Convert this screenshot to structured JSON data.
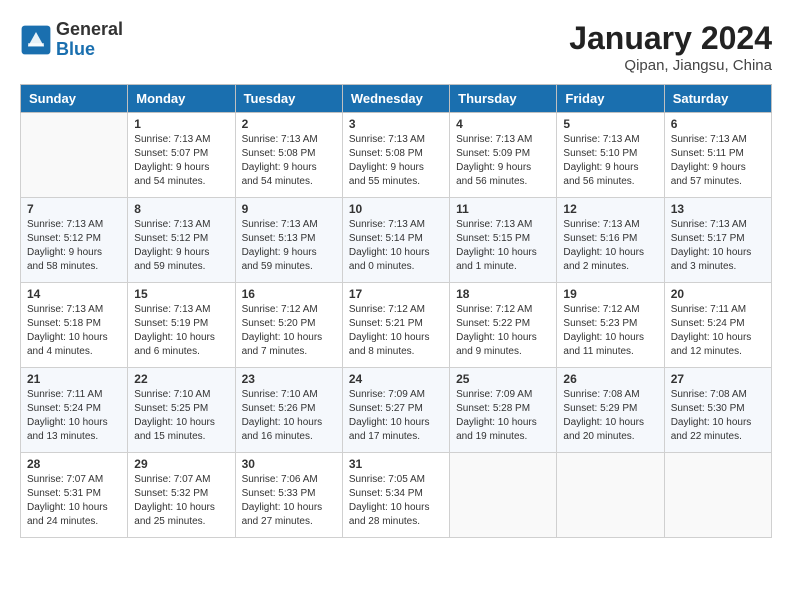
{
  "header": {
    "logo_general": "General",
    "logo_blue": "Blue",
    "month_title": "January 2024",
    "subtitle": "Qipan, Jiangsu, China"
  },
  "weekdays": [
    "Sunday",
    "Monday",
    "Tuesday",
    "Wednesday",
    "Thursday",
    "Friday",
    "Saturday"
  ],
  "weeks": [
    [
      {
        "day": "",
        "info": ""
      },
      {
        "day": "1",
        "info": "Sunrise: 7:13 AM\nSunset: 5:07 PM\nDaylight: 9 hours\nand 54 minutes."
      },
      {
        "day": "2",
        "info": "Sunrise: 7:13 AM\nSunset: 5:08 PM\nDaylight: 9 hours\nand 54 minutes."
      },
      {
        "day": "3",
        "info": "Sunrise: 7:13 AM\nSunset: 5:08 PM\nDaylight: 9 hours\nand 55 minutes."
      },
      {
        "day": "4",
        "info": "Sunrise: 7:13 AM\nSunset: 5:09 PM\nDaylight: 9 hours\nand 56 minutes."
      },
      {
        "day": "5",
        "info": "Sunrise: 7:13 AM\nSunset: 5:10 PM\nDaylight: 9 hours\nand 56 minutes."
      },
      {
        "day": "6",
        "info": "Sunrise: 7:13 AM\nSunset: 5:11 PM\nDaylight: 9 hours\nand 57 minutes."
      }
    ],
    [
      {
        "day": "7",
        "info": "Sunrise: 7:13 AM\nSunset: 5:12 PM\nDaylight: 9 hours\nand 58 minutes."
      },
      {
        "day": "8",
        "info": "Sunrise: 7:13 AM\nSunset: 5:12 PM\nDaylight: 9 hours\nand 59 minutes."
      },
      {
        "day": "9",
        "info": "Sunrise: 7:13 AM\nSunset: 5:13 PM\nDaylight: 9 hours\nand 59 minutes."
      },
      {
        "day": "10",
        "info": "Sunrise: 7:13 AM\nSunset: 5:14 PM\nDaylight: 10 hours\nand 0 minutes."
      },
      {
        "day": "11",
        "info": "Sunrise: 7:13 AM\nSunset: 5:15 PM\nDaylight: 10 hours\nand 1 minute."
      },
      {
        "day": "12",
        "info": "Sunrise: 7:13 AM\nSunset: 5:16 PM\nDaylight: 10 hours\nand 2 minutes."
      },
      {
        "day": "13",
        "info": "Sunrise: 7:13 AM\nSunset: 5:17 PM\nDaylight: 10 hours\nand 3 minutes."
      }
    ],
    [
      {
        "day": "14",
        "info": "Sunrise: 7:13 AM\nSunset: 5:18 PM\nDaylight: 10 hours\nand 4 minutes."
      },
      {
        "day": "15",
        "info": "Sunrise: 7:13 AM\nSunset: 5:19 PM\nDaylight: 10 hours\nand 6 minutes."
      },
      {
        "day": "16",
        "info": "Sunrise: 7:12 AM\nSunset: 5:20 PM\nDaylight: 10 hours\nand 7 minutes."
      },
      {
        "day": "17",
        "info": "Sunrise: 7:12 AM\nSunset: 5:21 PM\nDaylight: 10 hours\nand 8 minutes."
      },
      {
        "day": "18",
        "info": "Sunrise: 7:12 AM\nSunset: 5:22 PM\nDaylight: 10 hours\nand 9 minutes."
      },
      {
        "day": "19",
        "info": "Sunrise: 7:12 AM\nSunset: 5:23 PM\nDaylight: 10 hours\nand 11 minutes."
      },
      {
        "day": "20",
        "info": "Sunrise: 7:11 AM\nSunset: 5:24 PM\nDaylight: 10 hours\nand 12 minutes."
      }
    ],
    [
      {
        "day": "21",
        "info": "Sunrise: 7:11 AM\nSunset: 5:24 PM\nDaylight: 10 hours\nand 13 minutes."
      },
      {
        "day": "22",
        "info": "Sunrise: 7:10 AM\nSunset: 5:25 PM\nDaylight: 10 hours\nand 15 minutes."
      },
      {
        "day": "23",
        "info": "Sunrise: 7:10 AM\nSunset: 5:26 PM\nDaylight: 10 hours\nand 16 minutes."
      },
      {
        "day": "24",
        "info": "Sunrise: 7:09 AM\nSunset: 5:27 PM\nDaylight: 10 hours\nand 17 minutes."
      },
      {
        "day": "25",
        "info": "Sunrise: 7:09 AM\nSunset: 5:28 PM\nDaylight: 10 hours\nand 19 minutes."
      },
      {
        "day": "26",
        "info": "Sunrise: 7:08 AM\nSunset: 5:29 PM\nDaylight: 10 hours\nand 20 minutes."
      },
      {
        "day": "27",
        "info": "Sunrise: 7:08 AM\nSunset: 5:30 PM\nDaylight: 10 hours\nand 22 minutes."
      }
    ],
    [
      {
        "day": "28",
        "info": "Sunrise: 7:07 AM\nSunset: 5:31 PM\nDaylight: 10 hours\nand 24 minutes."
      },
      {
        "day": "29",
        "info": "Sunrise: 7:07 AM\nSunset: 5:32 PM\nDaylight: 10 hours\nand 25 minutes."
      },
      {
        "day": "30",
        "info": "Sunrise: 7:06 AM\nSunset: 5:33 PM\nDaylight: 10 hours\nand 27 minutes."
      },
      {
        "day": "31",
        "info": "Sunrise: 7:05 AM\nSunset: 5:34 PM\nDaylight: 10 hours\nand 28 minutes."
      },
      {
        "day": "",
        "info": ""
      },
      {
        "day": "",
        "info": ""
      },
      {
        "day": "",
        "info": ""
      }
    ]
  ]
}
